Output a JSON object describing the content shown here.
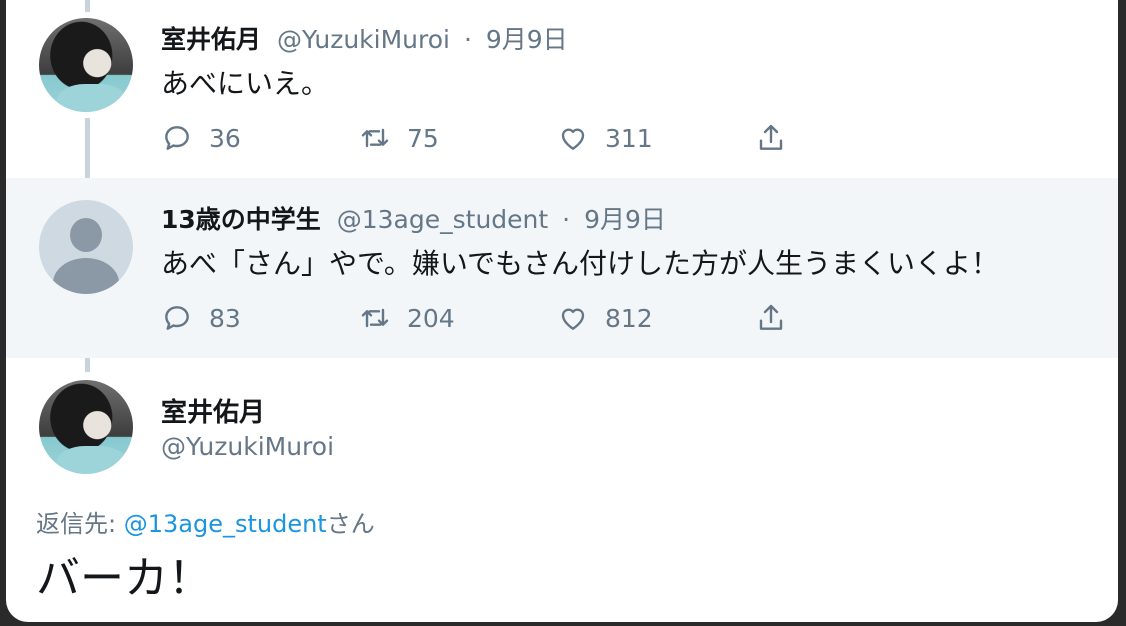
{
  "tweets": [
    {
      "name": "室井佑月",
      "handle": "@YuzukiMuroi",
      "dot": "·",
      "date": "9月9日",
      "text": "あべにいえ。",
      "reply_count": "36",
      "retweet_count": "75",
      "like_count": "311"
    },
    {
      "name": "13歳の中学生",
      "handle": "@13age_student",
      "dot": "·",
      "date": "9月9日",
      "text": "あべ「さん」やで。嫌いでもさん付けした方が人生うまくいくよ！",
      "reply_count": "83",
      "retweet_count": "204",
      "like_count": "812"
    }
  ],
  "main_tweet": {
    "name": "室井佑月",
    "handle": "@YuzukiMuroi",
    "reply_prefix": "返信先: ",
    "reply_mention": "@13age_student",
    "reply_suffix": "さん",
    "text": "バーカ！"
  },
  "colors": {
    "accent": "#1b95e0",
    "secondary_text": "#657786",
    "thread_line": "#c9d3db"
  },
  "icons": [
    "reply-icon",
    "retweet-icon",
    "like-icon",
    "share-icon"
  ]
}
